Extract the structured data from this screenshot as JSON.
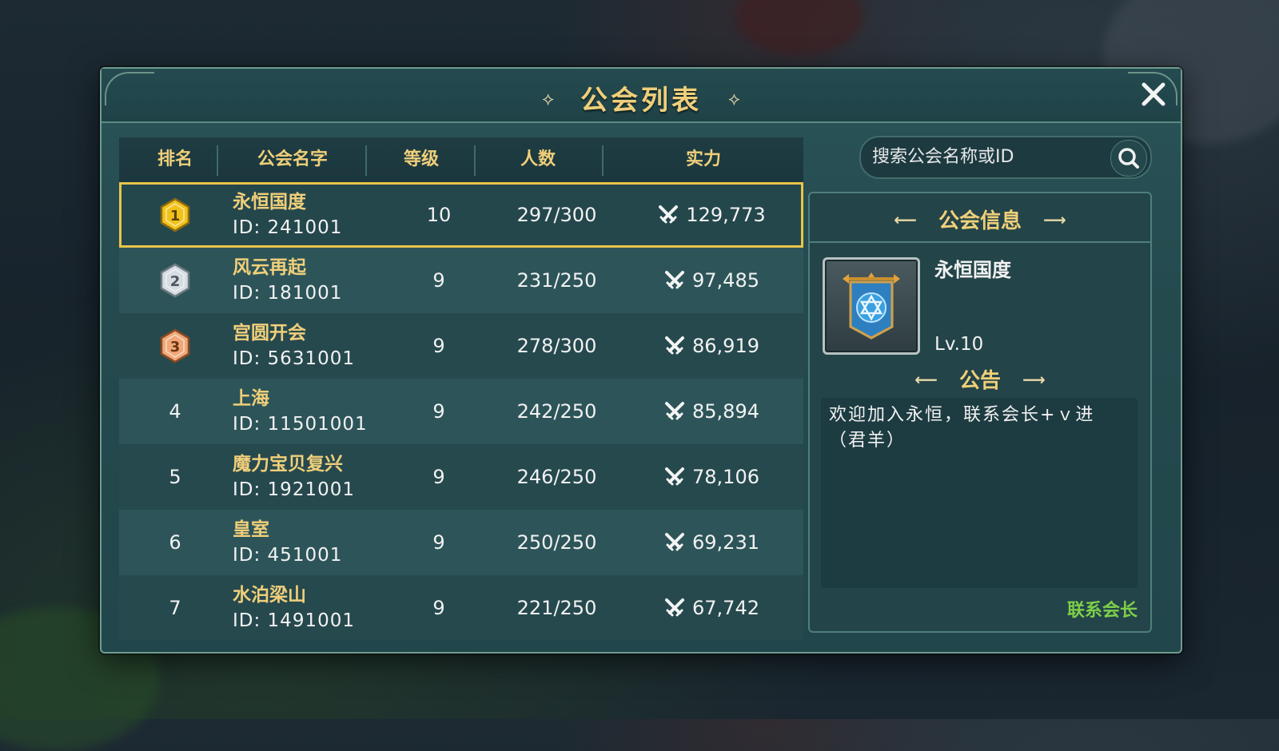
{
  "dialog": {
    "title": "公会列表",
    "close_icon": "close-icon"
  },
  "table": {
    "headers": [
      "排名",
      "公会名字",
      "等级",
      "人数",
      "实力"
    ],
    "rows": [
      {
        "rank": "1",
        "name": "永恒国度",
        "id": "ID: 241001",
        "level": "10",
        "members": "297/300",
        "power": "129,773",
        "medal": "gold"
      },
      {
        "rank": "2",
        "name": "风云再起",
        "id": "ID: 181001",
        "level": "9",
        "members": "231/250",
        "power": "97,485",
        "medal": "silver"
      },
      {
        "rank": "3",
        "name": "宫圆开会",
        "id": "ID: 5631001",
        "level": "9",
        "members": "278/300",
        "power": "86,919",
        "medal": "bronze"
      },
      {
        "rank": "4",
        "name": "上海",
        "id": "ID: 11501001",
        "level": "9",
        "members": "242/250",
        "power": "85,894"
      },
      {
        "rank": "5",
        "name": "魔力宝贝复兴",
        "id": "ID: 1921001",
        "level": "9",
        "members": "246/250",
        "power": "78,106"
      },
      {
        "rank": "6",
        "name": "皇室",
        "id": "ID: 451001",
        "level": "9",
        "members": "250/250",
        "power": "69,231"
      },
      {
        "rank": "7",
        "name": "水泊梁山",
        "id": "ID: 1491001",
        "level": "9",
        "members": "221/250",
        "power": "67,742"
      }
    ]
  },
  "search": {
    "placeholder": "搜索公会名称或ID"
  },
  "info": {
    "title": "公会信息",
    "guild_name": "永恒国度",
    "level": "Lv.10",
    "notice_title": "公告",
    "notice_text": "欢迎加入永恒，联系会长+ｖ进（君羊）",
    "contact_label": "联系会长"
  },
  "colors": {
    "gold_text": "#f0cf7a",
    "selected_outline": "#e8c44a",
    "contact_green": "#7ecf4a"
  }
}
